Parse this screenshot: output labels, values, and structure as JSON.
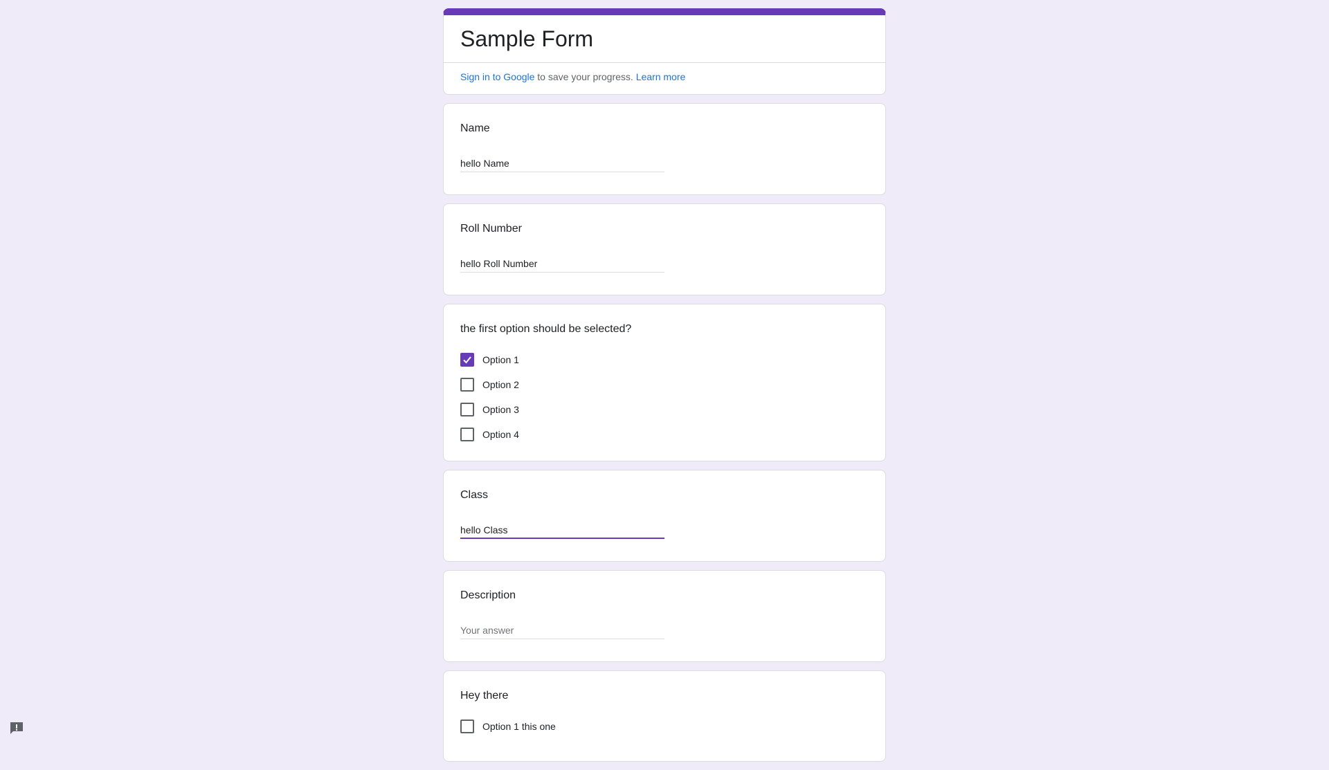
{
  "form": {
    "title": "Sample Form",
    "signin_link": "Sign in to Google",
    "signin_text": " to save your progress. ",
    "learn_more": "Learn more"
  },
  "questions": [
    {
      "title": "Name",
      "type": "text",
      "value": "hello Name"
    },
    {
      "title": "Roll Number",
      "type": "text",
      "value": "hello Roll Number"
    },
    {
      "title": "the first option should be selected?",
      "type": "checkbox",
      "options": [
        {
          "label": "Option 1",
          "checked": true
        },
        {
          "label": "Option 2",
          "checked": false
        },
        {
          "label": "Option 3",
          "checked": false
        },
        {
          "label": "Option 4",
          "checked": false
        }
      ]
    },
    {
      "title": "Class",
      "type": "text",
      "value": "hello Class",
      "focused": true
    },
    {
      "title": "Description",
      "type": "text",
      "value": "",
      "placeholder": "Your answer"
    },
    {
      "title": "Hey there",
      "type": "checkbox",
      "options": [
        {
          "label": "Option 1 this one",
          "checked": false
        }
      ]
    }
  ],
  "icons": {
    "report": "report-problem-icon"
  },
  "colors": {
    "accent": "#673ab7",
    "background": "#f0ebf8",
    "link": "#1a73e8"
  }
}
